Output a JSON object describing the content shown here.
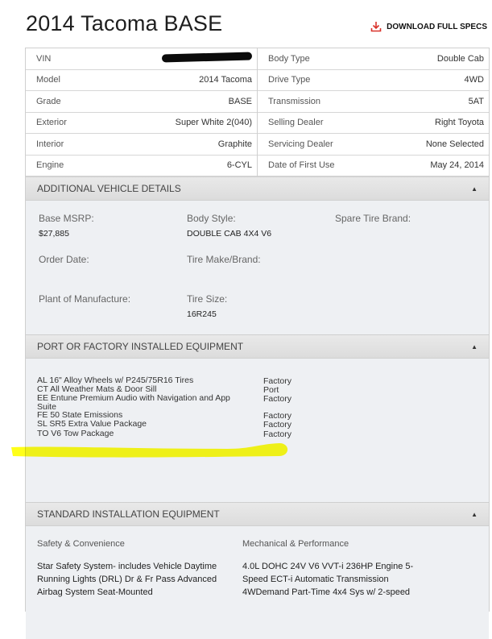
{
  "title": "2014 Tacoma BASE",
  "download_label": "DOWNLOAD FULL SPECS",
  "specs_left": [
    {
      "label": "VIN",
      "value": ""
    },
    {
      "label": "Model",
      "value": "2014 Tacoma"
    },
    {
      "label": "Grade",
      "value": "BASE"
    },
    {
      "label": "Exterior",
      "value": "Super White 2(040)"
    },
    {
      "label": "Interior",
      "value": "Graphite"
    },
    {
      "label": "Engine",
      "value": "6-CYL"
    }
  ],
  "specs_right": [
    {
      "label": "Body Type",
      "value": "Double Cab"
    },
    {
      "label": "Drive Type",
      "value": "4WD"
    },
    {
      "label": "Transmission",
      "value": "5AT"
    },
    {
      "label": "Selling Dealer",
      "value": "Right Toyota"
    },
    {
      "label": "Servicing Dealer",
      "value": "None Selected"
    },
    {
      "label": "Date of First Use",
      "value": "May 24, 2014"
    }
  ],
  "additional": {
    "heading": "ADDITIONAL VEHICLE DETAILS",
    "items": [
      {
        "label": "Base MSRP:",
        "value": "$27,885"
      },
      {
        "label": "Body Style:",
        "value": "DOUBLE CAB 4X4 V6"
      },
      {
        "label": "Spare Tire Brand:",
        "value": ""
      },
      {
        "label": "Order Date:",
        "value": ""
      },
      {
        "label": "Tire Make/Brand:",
        "value": ""
      },
      {
        "label": "Plant of Manufacture:",
        "value": ""
      },
      {
        "label": "Tire Size:",
        "value": "16R245"
      }
    ]
  },
  "installed": {
    "heading": "PORT OR FACTORY INSTALLED EQUIPMENT",
    "items": [
      {
        "name": "AL 16\" Alloy Wheels w/ P245/75R16 Tires",
        "source": "Factory"
      },
      {
        "name": "CT All Weather Mats & Door Sill",
        "source": "Port"
      },
      {
        "name": "EE Entune Premium Audio with Navigation and App Suite",
        "source": "Factory"
      },
      {
        "name": "FE 50 State Emissions",
        "source": "Factory"
      },
      {
        "name": "SL SR5 Extra Value Package",
        "source": "Factory"
      },
      {
        "name": "TO V6 Tow Package",
        "source": "Factory"
      }
    ]
  },
  "standard": {
    "heading": "STANDARD INSTALLATION EQUIPMENT",
    "col1_title": "Safety & Convenience",
    "col1_text": "Star Safety System- includes Vehicle Daytime Running Lights (DRL) Dr & Fr Pass Advanced Airbag System Seat-Mounted",
    "col2_title": "Mechanical & Performance",
    "col2_text": "4.0L DOHC 24V V6 VVT-i 236HP Engine 5-Speed ECT-i Automatic Transmission 4WDemand Part-Time 4x4 Sys w/ 2-speed"
  },
  "colors": {
    "highlight": "#ffff00",
    "download_icon": "#d9322b"
  }
}
